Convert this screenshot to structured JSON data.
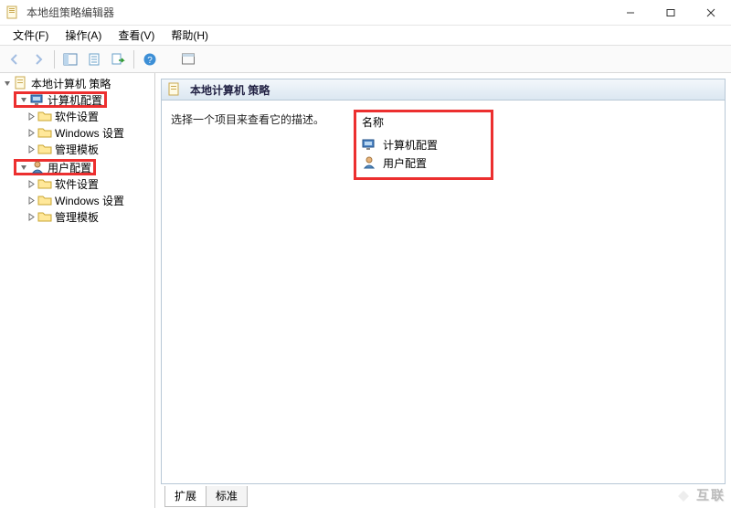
{
  "window": {
    "title": "本地组策略编辑器"
  },
  "menus": {
    "file": "文件(F)",
    "action": "操作(A)",
    "view": "查看(V)",
    "help": "帮助(H)"
  },
  "tree": {
    "root": "本地计算机 策略",
    "computer_config": "计算机配置",
    "software_settings": "软件设置",
    "windows_settings": "Windows 设置",
    "admin_templates": "管理模板",
    "user_config": "用户配置"
  },
  "right": {
    "header": "本地计算机 策略",
    "description_hint": "选择一个项目来查看它的描述。",
    "col_name": "名称",
    "items": {
      "computer_config": "计算机配置",
      "user_config": "用户配置"
    }
  },
  "tabs": {
    "extended": "扩展",
    "standard": "标准"
  },
  "watermark": "互联"
}
